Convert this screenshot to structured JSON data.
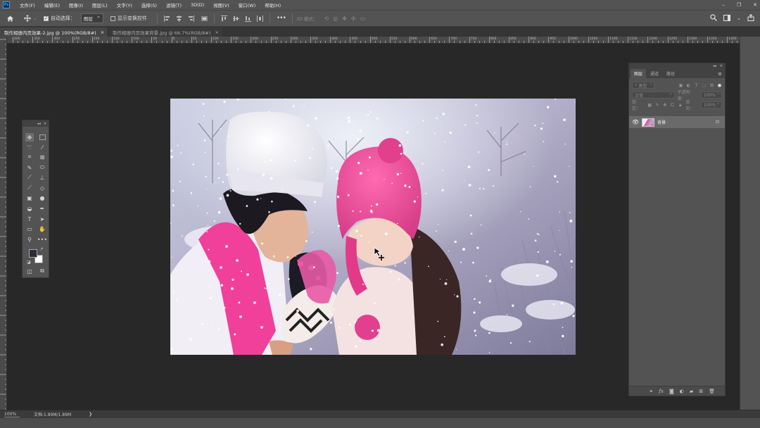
{
  "menubar": {
    "logo": "Ps",
    "items": [
      "文件(F)",
      "编辑(E)",
      "图像(I)",
      "图层(L)",
      "文字(Y)",
      "选择(S)",
      "滤镜(T)",
      "3D(D)",
      "视图(V)",
      "窗口(W)",
      "帮助(H)"
    ],
    "window_controls": [
      "–",
      "❐",
      "✕"
    ]
  },
  "optionsbar": {
    "auto_select_label": "自动选择：",
    "auto_select_value": "图层",
    "show_transform_label": "显示变换控件",
    "mode_3d_label": "3D 模式："
  },
  "tabs": [
    {
      "label": "制作相册内页效果-2.jpg @ 100%(RGB/8#)",
      "close": "×",
      "active": true
    },
    {
      "label": "制作相册内页效果背景.jpg @ 66.7%(RGB/8#)",
      "close": "×",
      "active": false
    }
  ],
  "ruler": {
    "top_labels": [
      "400",
      "350",
      "300",
      "250",
      "200",
      "150",
      "100",
      "50",
      "0",
      "50",
      "100",
      "150",
      "200",
      "250",
      "300",
      "350",
      "400",
      "450",
      "500",
      "550",
      "600",
      "650",
      "700",
      "750",
      "800",
      "850",
      "900",
      "950",
      "1000",
      "1050",
      "1100",
      "1150",
      "1200",
      "1250",
      "1300",
      "1350",
      "1400"
    ]
  },
  "layers_panel": {
    "tabs": [
      "图层",
      "通道",
      "路径"
    ],
    "filter_label": "类型",
    "blend_mode": "正常",
    "opacity_label": "不透明度：",
    "opacity_value": "100%",
    "lock_label": "锁定：",
    "fill_label": "填充：",
    "fill_value": "100%",
    "layer_name": "背景"
  },
  "statusbar": {
    "zoom": "100%",
    "doc_info": "文档:1.89M/1.89M",
    "arrow": "❯"
  },
  "colors": {
    "foreground": "#2b2d3a",
    "background": "#ffffff",
    "accent": "#31a8ff"
  }
}
